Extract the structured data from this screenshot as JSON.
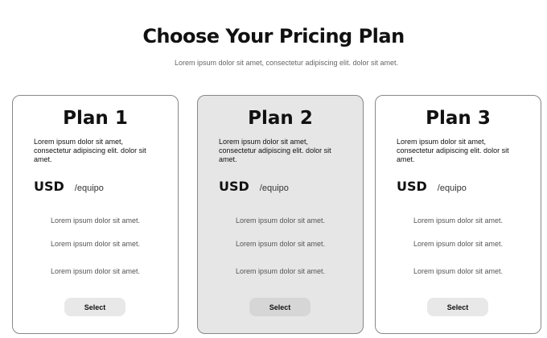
{
  "header": {
    "title": "Choose Your Pricing Plan",
    "subtitle": "Lorem ipsum dolor sit amet, consectetur adipiscing elit.   dolor sit amet."
  },
  "plans": [
    {
      "name": "Plan 1",
      "description": "Lorem ipsum dolor sit amet, consectetur adipiscing elit.  dolor sit amet.",
      "currency": "USD",
      "period": "/equipo",
      "features": [
        "Lorem ipsum dolor sit amet.",
        "Lorem ipsum dolor sit amet.",
        "Lorem ipsum dolor sit amet."
      ],
      "button": "Select"
    },
    {
      "name": "Plan 2",
      "description": "Lorem ipsum dolor sit amet, consectetur adipiscing elit.  dolor sit amet.",
      "currency": "USD",
      "period": "/equipo",
      "features": [
        "Lorem ipsum dolor sit amet.",
        "Lorem ipsum dolor sit amet.",
        "Lorem ipsum dolor sit amet."
      ],
      "button": "Select"
    },
    {
      "name": "Plan 3",
      "description": "Lorem ipsum dolor sit amet, consectetur adipiscing elit.  dolor sit amet.",
      "currency": "USD",
      "period": "/equipo",
      "features": [
        "Lorem ipsum dolor sit amet.",
        "Lorem ipsum dolor sit amet.",
        "Lorem ipsum dolor sit amet."
      ],
      "button": "Select"
    }
  ]
}
